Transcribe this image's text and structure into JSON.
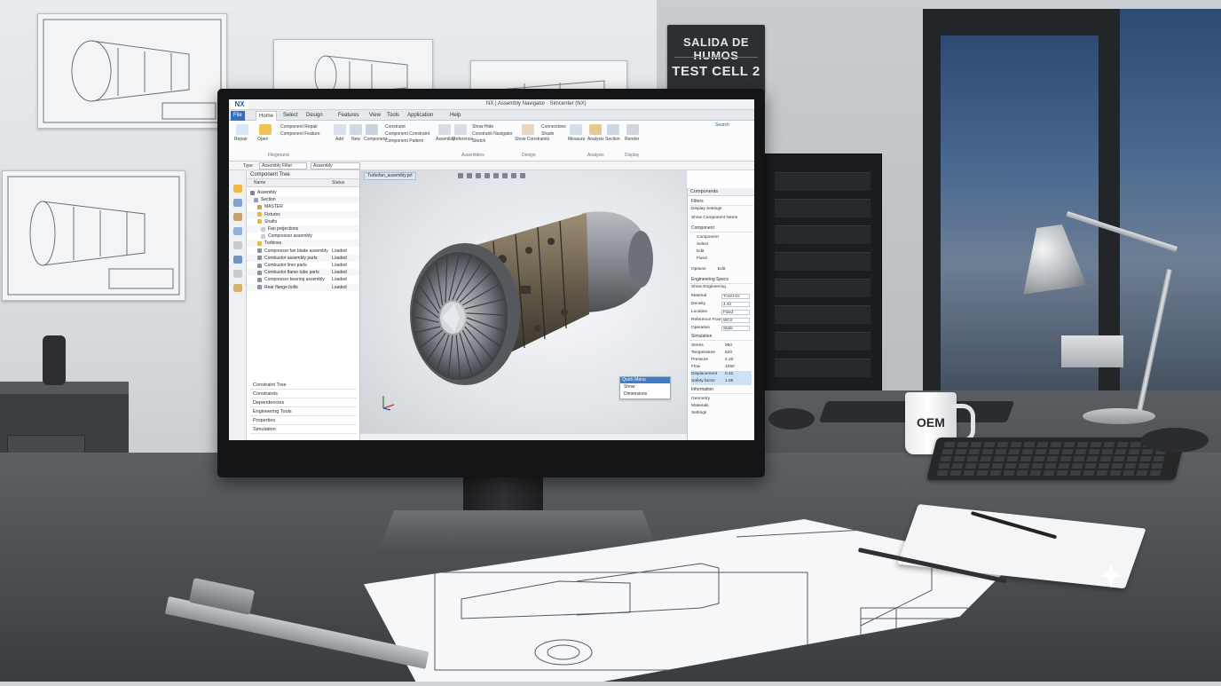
{
  "scene": {
    "sign": {
      "line1": "SALIDA DE HUMOS",
      "line2": "TEST CELL 2"
    },
    "mug_label": "OEM"
  },
  "app": {
    "logo": "NX",
    "window_title": "NX | Assembly Navigator · Simcenter (NX)",
    "tabs": [
      "File",
      "Home",
      "Select",
      "Design",
      "Features",
      "View",
      "Tools",
      "Application",
      "Help"
    ],
    "active_tab": "Home",
    "ribbon": {
      "group_left": [
        "Repair",
        "Open",
        "Component Repair",
        "Component Feature"
      ],
      "group_label": "Fileground",
      "group_mid": [
        "Add",
        "New",
        "Component",
        "Constraint",
        "Component Constraint",
        "Component Pattern"
      ],
      "group_mid2": [
        "Assembly",
        "Reference",
        "Show Hide",
        "Constraint Navigator",
        "Sketch"
      ],
      "group_right": [
        "Show Constraints",
        "Connections",
        "Shade",
        "Measure",
        "Analysis",
        "Section",
        "Render"
      ],
      "group_labels": [
        "Assemblies",
        "Design",
        "Analysis",
        "Display"
      ],
      "search_label": "Search"
    },
    "quickbar": {
      "filter_label": "Type",
      "filter_value": "Assembly Filter",
      "scope_value": "Assembly"
    },
    "viewport_tab": "Turbofan_assembly.prt",
    "navigator": {
      "title": "Component Tree",
      "col_name": "Name",
      "col_value": "Status",
      "rows": [
        {
          "label": "Assembly",
          "value": ""
        },
        {
          "label": "Section",
          "value": ""
        },
        {
          "label": "MASTER",
          "value": ""
        },
        {
          "label": "Fixtures",
          "value": ""
        },
        {
          "label": "Shafts",
          "value": ""
        },
        {
          "label": "Fan projections",
          "value": ""
        },
        {
          "label": "Compressor assembly",
          "value": ""
        },
        {
          "label": "Turbines",
          "value": ""
        },
        {
          "label": "Compressor fan blade assembly",
          "value": "Loaded"
        },
        {
          "label": "Combustor assembly parts",
          "value": "Loaded"
        },
        {
          "label": "Combustor liner parts",
          "value": "Loaded"
        },
        {
          "label": "Combustor flame tube parts",
          "value": "Loaded"
        },
        {
          "label": "Compressor bearing assembly",
          "value": "Loaded"
        },
        {
          "label": "Rear flange bolts",
          "value": "Loaded"
        }
      ],
      "sections": [
        "Constraint Tree",
        "Constraints",
        "Dependencies",
        "Engineering Tools",
        "Properties",
        "Simulation"
      ]
    },
    "popup": {
      "title": "Quick Menu",
      "items": [
        "Show",
        "Dimensions"
      ]
    },
    "right_panel": {
      "title": "Components",
      "sec1": "Filters",
      "field1": "Display Settings",
      "check1": "Show Component Name",
      "sec2": "Component",
      "sub_rows": [
        "Component",
        "Select",
        "Edit",
        "Fixed"
      ],
      "buttons": [
        "Options",
        "Edit"
      ],
      "sec3": "Engineering Specs",
      "check2": "Show Engineering",
      "props": [
        {
          "k": "Material",
          "v": "Ti-6Al-4V"
        },
        {
          "k": "Density",
          "v": "4.43"
        },
        {
          "k": "Location",
          "v": "Fixed"
        },
        {
          "k": "Reference Frame",
          "v": "WCS"
        },
        {
          "k": "Operation",
          "v": "Static"
        }
      ],
      "sec4": "Simulation",
      "list": [
        {
          "k": "Stress",
          "v": "850",
          "hl": false
        },
        {
          "k": "Temperature",
          "v": "620",
          "hl": false
        },
        {
          "k": "Pressure",
          "v": "4.20",
          "hl": false
        },
        {
          "k": "Flow",
          "v": "1050",
          "hl": false
        },
        {
          "k": "Displacement",
          "v": "0.42",
          "hl": true
        },
        {
          "k": "Safety factor",
          "v": "1.85",
          "hl": true
        }
      ],
      "sec5": "Information",
      "checks": [
        "Geometry",
        "Materials",
        "Settings"
      ]
    }
  }
}
